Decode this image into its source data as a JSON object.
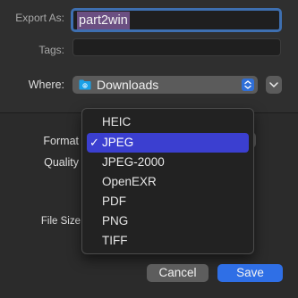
{
  "export_as": {
    "label": "Export As:",
    "value": "part2win"
  },
  "tags": {
    "label": "Tags:",
    "value": ""
  },
  "where": {
    "label": "Where:",
    "value": "Downloads",
    "icon": "folder-icon"
  },
  "options": {
    "format_label": "Format",
    "quality_label": "Quality",
    "file_size_label": "File Size"
  },
  "format_menu": {
    "items": [
      "HEIC",
      "JPEG",
      "JPEG-2000",
      "OpenEXR",
      "PDF",
      "PNG",
      "TIFF"
    ],
    "selected": "JPEG",
    "check_glyph": "✓"
  },
  "buttons": {
    "cancel": "Cancel",
    "save": "Save"
  },
  "colors": {
    "accent": "#2f6fe6",
    "menu_selection": "#3b3fd0",
    "text_selection": "#6b4f82",
    "folder_icon": "#1aa1e8"
  }
}
